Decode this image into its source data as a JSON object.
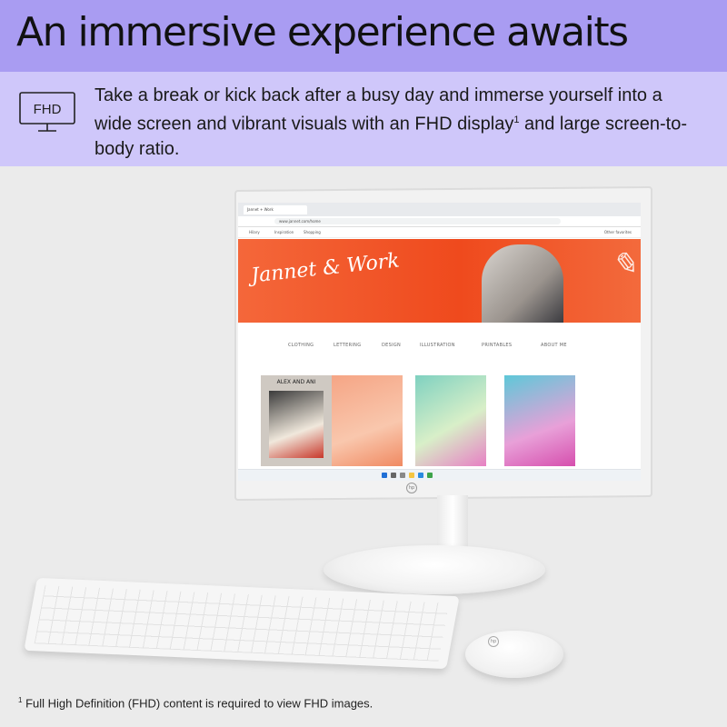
{
  "header": {
    "title": "An immersive experience awaits"
  },
  "feature": {
    "icon_label": "FHD",
    "icon_name": "monitor-icon",
    "text_before": "Take a break or kick back after a busy day and immerse yourself into a wide screen and vibrant visuals with an FHD display",
    "footnote_ref": "1",
    "text_after": " and large screen-to-body ratio."
  },
  "screen": {
    "tab_title": "Jannet + Work",
    "url": "www.jannet.com/home",
    "favorites": [
      "Hilary",
      "Inspiration",
      "Shopping"
    ],
    "other_favorites": "Other favorites",
    "hero_logo": "Jannet & Work",
    "nav": [
      "CLOTHING",
      "LETTERING",
      "DESIGN",
      "ILLUSTRATION",
      "PRINTABLES",
      "ABOUT ME"
    ],
    "cards": [
      {
        "label": "ALEX AND ANI",
        "color": "#cfc9c2"
      },
      {
        "label": "",
        "color": "#f7b59a"
      },
      {
        "label": "",
        "color": "#8fd6c2"
      },
      {
        "label": "",
        "color": "#e57ec6"
      }
    ]
  },
  "footnote": {
    "marker": "1",
    "text": "Full High Definition (FHD) content is required to view FHD images."
  },
  "colors": {
    "header_bg": "#a99cf2",
    "band_bg": "#cfc7fa",
    "accent_orange": "#f25a2a"
  }
}
